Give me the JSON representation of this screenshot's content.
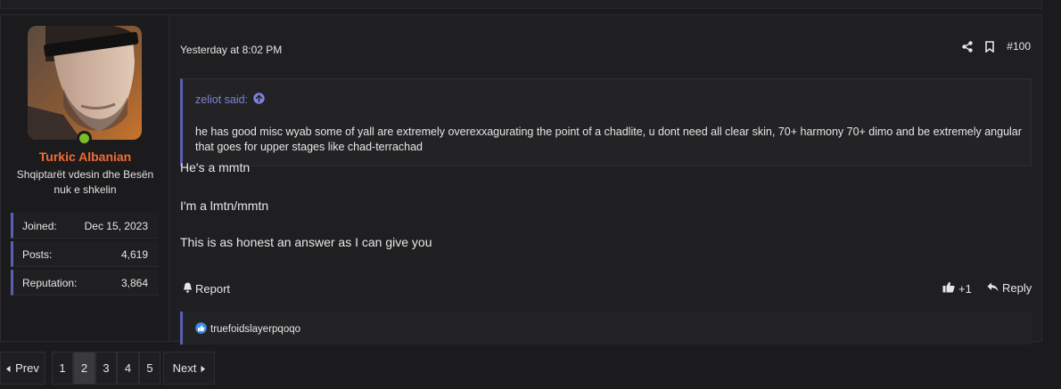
{
  "post": {
    "timestamp": "Yesterday at 8:02 PM",
    "number": "#100",
    "quote": {
      "author": "zeliot said:",
      "text": "he has good misc wyab some of yall are extremely overexxagurating the point of a chadlite, u dont need all clear skin, 70+ harmony 70+ dimo and be extremely angular that goes for upper stages like chad-terrachad"
    },
    "paragraphs": [
      "He's a mmtn",
      "I'm a lmtn/mmtn",
      "This is as honest an answer as I can give you"
    ],
    "actions": {
      "report": "Report",
      "like_count": "+1",
      "reply": "Reply"
    },
    "reactions_by": "truefoidslayerpqoqo"
  },
  "user": {
    "name": "Turkic Albanian",
    "title": "Shqiptarët vdesin dhe Besën nuk e shkelin",
    "stats": [
      {
        "label": "Joined:",
        "value": "Dec 15, 2023"
      },
      {
        "label": "Posts:",
        "value": "4,619"
      },
      {
        "label": "Reputation:",
        "value": "3,864"
      }
    ]
  },
  "pagination": {
    "prev": "Prev",
    "next": "Next",
    "pages": [
      "1",
      "2",
      "3",
      "4",
      "5"
    ],
    "current": "2"
  },
  "colors": {
    "accent": "#5b5fb3",
    "username": "#f36b32",
    "online": "#7cbd2a",
    "quote_link": "#7c82d8"
  }
}
